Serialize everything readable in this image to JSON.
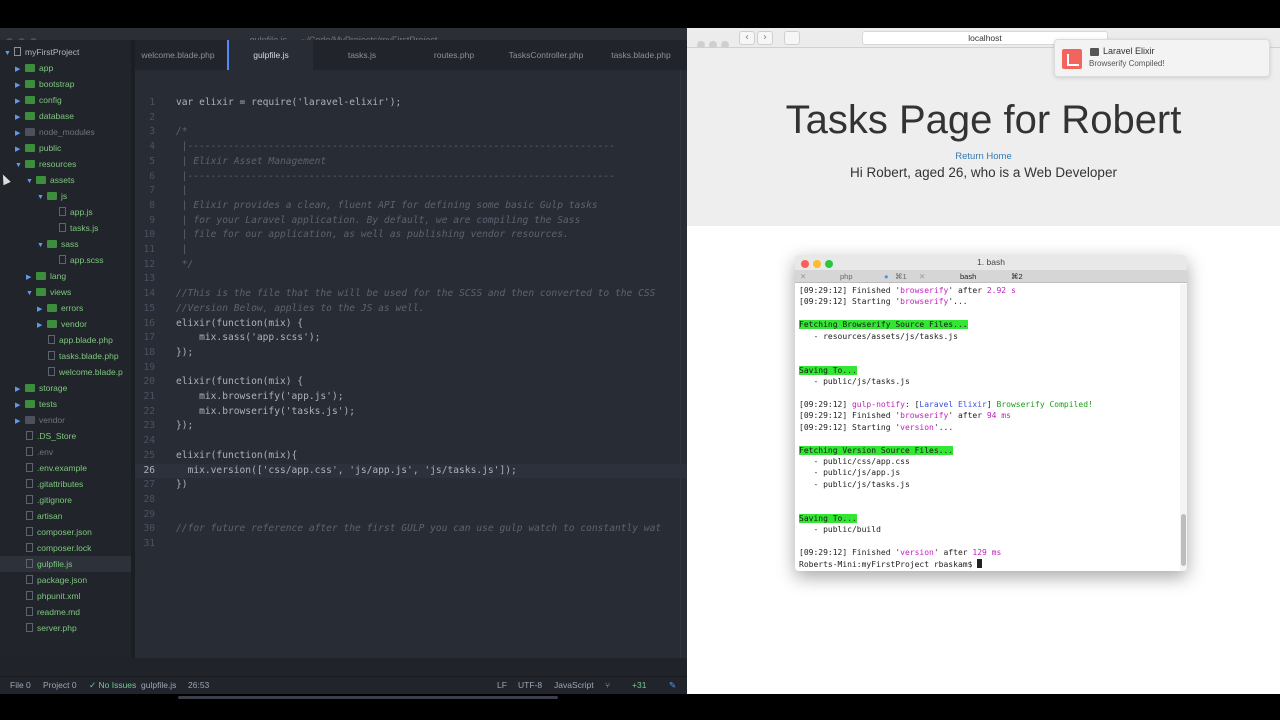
{
  "editor": {
    "window_title": "gulpfile.js — ~/Code/MyProjects/myFirstProject",
    "tree": {
      "rows": [
        {
          "label": "myFirstProject",
          "kind": "root",
          "level": 0,
          "expanded": true
        },
        {
          "label": "app",
          "kind": "folder",
          "level": 1,
          "expanded": false
        },
        {
          "label": "bootstrap",
          "kind": "folder",
          "level": 1,
          "expanded": false
        },
        {
          "label": "config",
          "kind": "folder",
          "level": 1,
          "expanded": false
        },
        {
          "label": "database",
          "kind": "folder",
          "level": 1,
          "expanded": false
        },
        {
          "label": "node_modules",
          "kind": "folder-dim",
          "level": 1,
          "expanded": false
        },
        {
          "label": "public",
          "kind": "folder",
          "level": 1,
          "expanded": false
        },
        {
          "label": "resources",
          "kind": "folder",
          "level": 1,
          "expanded": true
        },
        {
          "label": "assets",
          "kind": "folder",
          "level": 2,
          "expanded": true
        },
        {
          "label": "js",
          "kind": "folder",
          "level": 3,
          "expanded": true
        },
        {
          "label": "app.js",
          "kind": "file",
          "level": 4
        },
        {
          "label": "tasks.js",
          "kind": "file",
          "level": 4
        },
        {
          "label": "sass",
          "kind": "folder",
          "level": 3,
          "expanded": true
        },
        {
          "label": "app.scss",
          "kind": "file",
          "level": 4
        },
        {
          "label": "lang",
          "kind": "folder",
          "level": 2,
          "expanded": false
        },
        {
          "label": "views",
          "kind": "folder",
          "level": 2,
          "expanded": true
        },
        {
          "label": "errors",
          "kind": "folder",
          "level": 3,
          "expanded": false
        },
        {
          "label": "vendor",
          "kind": "folder",
          "level": 3,
          "expanded": false
        },
        {
          "label": "app.blade.php",
          "kind": "file",
          "level": 3
        },
        {
          "label": "tasks.blade.php",
          "kind": "file",
          "level": 3
        },
        {
          "label": "welcome.blade.p",
          "kind": "file",
          "level": 3
        },
        {
          "label": "storage",
          "kind": "folder",
          "level": 1,
          "expanded": false
        },
        {
          "label": "tests",
          "kind": "folder",
          "level": 1,
          "expanded": false
        },
        {
          "label": "vendor",
          "kind": "folder-dim",
          "level": 1,
          "expanded": false
        },
        {
          "label": ".DS_Store",
          "kind": "file",
          "level": 1
        },
        {
          "label": ".env",
          "kind": "file-dim",
          "level": 1
        },
        {
          "label": ".env.example",
          "kind": "file",
          "level": 1
        },
        {
          "label": ".gitattributes",
          "kind": "file",
          "level": 1
        },
        {
          "label": ".gitignore",
          "kind": "file",
          "level": 1
        },
        {
          "label": "artisan",
          "kind": "file",
          "level": 1
        },
        {
          "label": "composer.json",
          "kind": "file",
          "level": 1
        },
        {
          "label": "composer.lock",
          "kind": "file",
          "level": 1
        },
        {
          "label": "gulpfile.js",
          "kind": "file",
          "level": 1,
          "active": true
        },
        {
          "label": "package.json",
          "kind": "file",
          "level": 1
        },
        {
          "label": "phpunit.xml",
          "kind": "file",
          "level": 1
        },
        {
          "label": "readme.md",
          "kind": "file",
          "level": 1
        },
        {
          "label": "server.php",
          "kind": "file",
          "level": 1
        }
      ]
    },
    "tabs": [
      {
        "label": "welcome.blade.php",
        "active": false
      },
      {
        "label": "gulpfile.js",
        "active": true
      },
      {
        "label": "tasks.js",
        "active": false
      },
      {
        "label": "routes.php",
        "active": false
      },
      {
        "label": "TasksController.php",
        "active": false
      },
      {
        "label": "tasks.blade.php",
        "active": false
      }
    ],
    "cursor_line": 26,
    "lines": [
      {
        "n": "1",
        "text": "var elixir = require('laravel-elixir');",
        "comment": false
      },
      {
        "n": "2",
        "text": "",
        "comment": false
      },
      {
        "n": "3",
        "text": "/*",
        "comment": true
      },
      {
        "n": "4",
        "text": " |--------------------------------------------------------------------------",
        "comment": true
      },
      {
        "n": "5",
        "text": " | Elixir Asset Management",
        "comment": true
      },
      {
        "n": "6",
        "text": " |--------------------------------------------------------------------------",
        "comment": true
      },
      {
        "n": "7",
        "text": " |",
        "comment": true
      },
      {
        "n": "8",
        "text": " | Elixir provides a clean, fluent API for defining some basic Gulp tasks",
        "comment": true
      },
      {
        "n": "9",
        "text": " | for your Laravel application. By default, we are compiling the Sass",
        "comment": true
      },
      {
        "n": "10",
        "text": " | file for our application, as well as publishing vendor resources.",
        "comment": true
      },
      {
        "n": "11",
        "text": " |",
        "comment": true
      },
      {
        "n": "12",
        "text": " */",
        "comment": true
      },
      {
        "n": "13",
        "text": "",
        "comment": false
      },
      {
        "n": "14",
        "text": "//This is the file that the will be used for the SCSS and then converted to the CSS",
        "comment": true
      },
      {
        "n": "15",
        "text": "//Version Below, applies to the JS as well.",
        "comment": true
      },
      {
        "n": "16",
        "text": "elixir(function(mix) {",
        "comment": false
      },
      {
        "n": "17",
        "text": "    mix.sass('app.scss');",
        "comment": false
      },
      {
        "n": "18",
        "text": "});",
        "comment": false
      },
      {
        "n": "19",
        "text": "",
        "comment": false
      },
      {
        "n": "20",
        "text": "elixir(function(mix) {",
        "comment": false
      },
      {
        "n": "21",
        "text": "    mix.browserify('app.js');",
        "comment": false
      },
      {
        "n": "22",
        "text": "    mix.browserify('tasks.js');",
        "comment": false
      },
      {
        "n": "23",
        "text": "});",
        "comment": false
      },
      {
        "n": "24",
        "text": "",
        "comment": false
      },
      {
        "n": "25",
        "text": "elixir(function(mix){",
        "comment": false
      },
      {
        "n": "26",
        "text": "  mix.version(['css/app.css', 'js/app.js', 'js/tasks.js']);",
        "comment": false
      },
      {
        "n": "27",
        "text": "})",
        "comment": false
      },
      {
        "n": "28",
        "text": "",
        "comment": false
      },
      {
        "n": "29",
        "text": "",
        "comment": false
      },
      {
        "n": "30",
        "text": "//for future reference after the first GULP you can use gulp watch to constantly wat",
        "comment": true
      },
      {
        "n": "31",
        "text": "",
        "comment": false
      }
    ],
    "status": {
      "file_count": "File 0",
      "project_count": "Project 0",
      "issues": "✓ No Issues",
      "file_name": "gulpfile.js",
      "cursor_pos": "26:53",
      "line_ending": "LF",
      "encoding": "UTF-8",
      "grammar": "JavaScript",
      "git_changes": "+31"
    }
  },
  "browser": {
    "url": "localhost",
    "page": {
      "title": "Tasks Page for Robert",
      "link": "Return Home",
      "subtitle": "Hi Robert, aged 26, who is a Web Developer"
    },
    "notification": {
      "title": "Laravel Elixir",
      "body": "Browserify Compiled!"
    }
  },
  "terminal": {
    "title": "1. bash",
    "tabs": [
      {
        "label": "php",
        "shortcut": "⌘1"
      },
      {
        "label": "bash",
        "shortcut": "⌘2"
      }
    ],
    "lines": [
      {
        "segs": [
          {
            "t": "[09:29:12] Finished '"
          },
          {
            "t": "browserify",
            "c": "mag"
          },
          {
            "t": "' after "
          },
          {
            "t": "2.92 s",
            "c": "mag"
          }
        ]
      },
      {
        "segs": [
          {
            "t": "[09:29:12] Starting '"
          },
          {
            "t": "browserify",
            "c": "mag"
          },
          {
            "t": "'..."
          }
        ]
      },
      {
        "segs": [
          {
            "t": ""
          }
        ]
      },
      {
        "segs": [
          {
            "t": "Fetching Browserify Source Files...",
            "c": "hl"
          }
        ]
      },
      {
        "segs": [
          {
            "t": "   - resources/assets/js/tasks.js"
          }
        ]
      },
      {
        "segs": [
          {
            "t": ""
          }
        ]
      },
      {
        "segs": [
          {
            "t": ""
          }
        ]
      },
      {
        "segs": [
          {
            "t": "Saving To...",
            "c": "hl"
          }
        ]
      },
      {
        "segs": [
          {
            "t": "   - public/js/tasks.js"
          }
        ]
      },
      {
        "segs": [
          {
            "t": ""
          }
        ]
      },
      {
        "segs": [
          {
            "t": "[09:29:12] "
          },
          {
            "t": "gulp-notify",
            "c": "mag"
          },
          {
            "t": ": ["
          },
          {
            "t": "Laravel Elixir",
            "c": "blu"
          },
          {
            "t": "] "
          },
          {
            "t": "Browserify Compiled!",
            "c": "grn"
          }
        ]
      },
      {
        "segs": [
          {
            "t": "[09:29:12] Finished '"
          },
          {
            "t": "browserify",
            "c": "mag"
          },
          {
            "t": "' after "
          },
          {
            "t": "94 ms",
            "c": "mag"
          }
        ]
      },
      {
        "segs": [
          {
            "t": "[09:29:12] Starting '"
          },
          {
            "t": "version",
            "c": "mag"
          },
          {
            "t": "'..."
          }
        ]
      },
      {
        "segs": [
          {
            "t": ""
          }
        ]
      },
      {
        "segs": [
          {
            "t": "Fetching Version Source Files...",
            "c": "hl"
          }
        ]
      },
      {
        "segs": [
          {
            "t": "   - public/css/app.css"
          }
        ]
      },
      {
        "segs": [
          {
            "t": "   - public/js/app.js"
          }
        ]
      },
      {
        "segs": [
          {
            "t": "   - public/js/tasks.js"
          }
        ]
      },
      {
        "segs": [
          {
            "t": ""
          }
        ]
      },
      {
        "segs": [
          {
            "t": ""
          }
        ]
      },
      {
        "segs": [
          {
            "t": "Saving To...",
            "c": "hl"
          }
        ]
      },
      {
        "segs": [
          {
            "t": "   - public/build"
          }
        ]
      },
      {
        "segs": [
          {
            "t": ""
          }
        ]
      },
      {
        "segs": [
          {
            "t": "[09:29:12] Finished '"
          },
          {
            "t": "version",
            "c": "mag"
          },
          {
            "t": "' after "
          },
          {
            "t": "129 ms",
            "c": "mag"
          }
        ]
      },
      {
        "segs": [
          {
            "t": "Roberts-Mini:myFirstProject rbaskam$ "
          }
        ],
        "prompt": true
      }
    ]
  }
}
